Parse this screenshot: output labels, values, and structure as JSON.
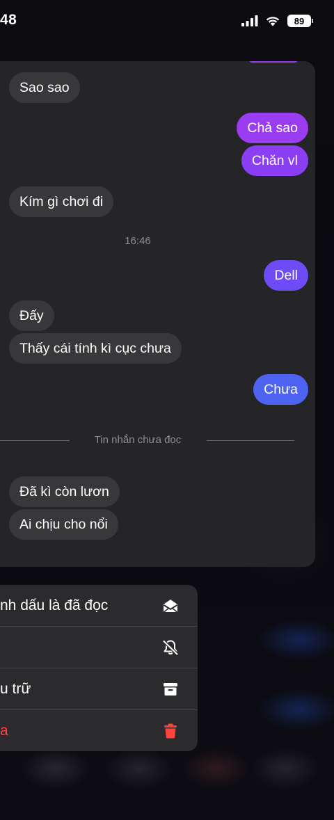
{
  "status_bar": {
    "time": "48",
    "battery": "89"
  },
  "chat": {
    "messages": [
      {
        "text": "Sao sao",
        "direction": "in"
      },
      {
        "text": "Chả sao",
        "direction": "out",
        "color": "#9a3df0"
      },
      {
        "text": "Chăn vl",
        "direction": "out",
        "color": "#8c3ef5"
      },
      {
        "text": "Kím gì chơi đi",
        "direction": "in"
      },
      {
        "text": "Dell",
        "direction": "out",
        "color": "#6d4cf7"
      },
      {
        "text": "Đấy",
        "direction": "in"
      },
      {
        "text": "Thấy cái tính kì cục chưa",
        "direction": "in"
      },
      {
        "text": "Chưa",
        "direction": "out",
        "color": "#4e63f2"
      },
      {
        "text": "Đã kì còn lươn",
        "direction": "in"
      },
      {
        "text": "Ai chịu cho nổi",
        "direction": "in"
      }
    ],
    "timestamp": "16:46",
    "unread_divider": "Tin nhắn chưa đọc"
  },
  "menu": {
    "items": [
      {
        "label": "nh dấu là đã đọc",
        "icon": "envelope-open-icon",
        "color": "#ffffff"
      },
      {
        "label": "",
        "icon": "bell-slash-icon",
        "color": "#ffffff"
      },
      {
        "label": "u trữ",
        "icon": "archive-box-icon",
        "color": "#ffffff"
      },
      {
        "label": "a",
        "icon": "trash-icon",
        "color": "#ff453a"
      }
    ]
  },
  "colors": {
    "incoming_bubble": "#38383b",
    "card_background": "#252527",
    "danger": "#ff453a"
  }
}
